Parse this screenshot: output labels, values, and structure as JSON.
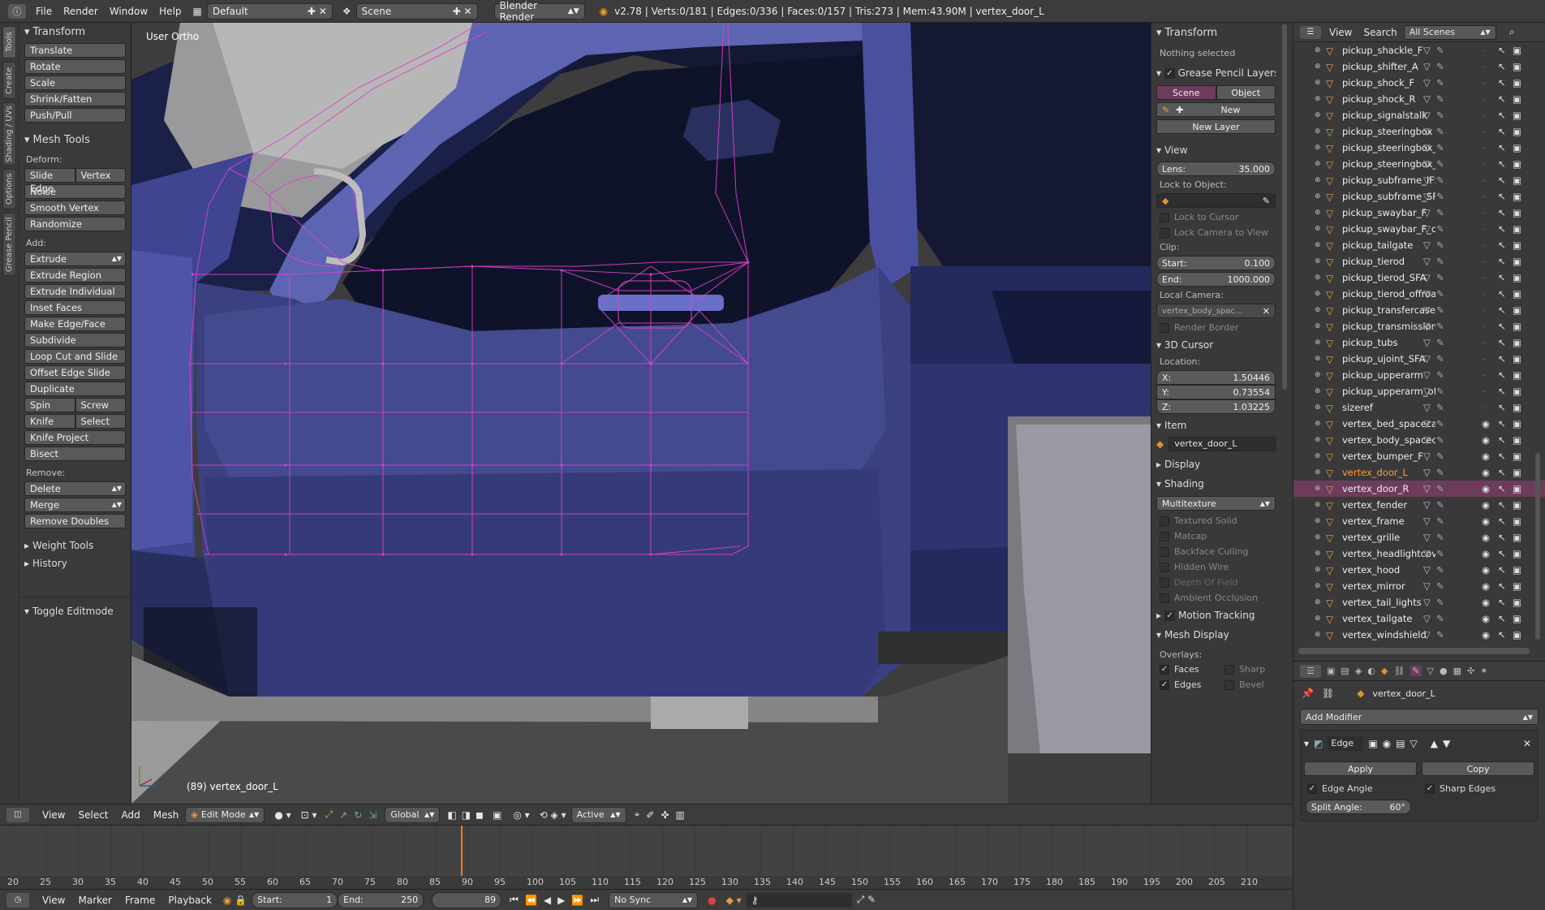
{
  "topbar": {
    "menus": [
      "File",
      "Render",
      "Window",
      "Help"
    ],
    "layout": "Default",
    "scene": "Scene",
    "engine": "Blender Render",
    "stats": "v2.78 | Verts:0/181 | Edges:0/336 | Faces:0/157 | Tris:273 | Mem:43.90M | vertex_door_L"
  },
  "left_tabs": [
    "Tools",
    "Create",
    "Shading / UVs",
    "Options",
    "Grease Pencil"
  ],
  "toolshelf": {
    "transform_title": "Transform",
    "transform": [
      "Translate",
      "Rotate",
      "Scale",
      "Shrink/Fatten",
      "Push/Pull"
    ],
    "mesh_tools_title": "Mesh Tools",
    "deform_label": "Deform:",
    "slide_edge": "Slide Edge",
    "vertex": "Vertex",
    "deform": [
      "Noise",
      "Smooth Vertex",
      "Randomize"
    ],
    "add_label": "Add:",
    "extrude": "Extrude",
    "add": [
      "Extrude Region",
      "Extrude Individual",
      "Inset Faces",
      "Make Edge/Face",
      "Subdivide",
      "Loop Cut and Slide",
      "Offset Edge Slide",
      "Duplicate"
    ],
    "spin": "Spin",
    "screw": "Screw",
    "knife": "Knife",
    "select": "Select",
    "add2": [
      "Knife Project",
      "Bisect"
    ],
    "remove_label": "Remove:",
    "delete": "Delete",
    "merge": "Merge",
    "remove_doubles": "Remove Doubles",
    "weight_tools": "Weight Tools",
    "history": "History",
    "toggle_editmode": "Toggle Editmode"
  },
  "viewport": {
    "view_name": "User Ortho",
    "object_label": "(89) vertex_door_L",
    "colors": {
      "body": "#3d4382",
      "body_light": "#5f66b4",
      "dark": "#151a3c",
      "wire": "#e040d0",
      "window": "#0e1022"
    }
  },
  "npanel": {
    "transform": "Transform",
    "nothing_selected": "Nothing selected",
    "grease_pencil": "Grease Pencil Layers",
    "scene_btn": "Scene",
    "object_btn": "Object",
    "new_btn": "New",
    "new_layer": "New Layer",
    "view": "View",
    "lens_label": "Lens:",
    "lens_value": "35.000",
    "lock_to_object": "Lock to Object:",
    "lock_cursor": "Lock to Cursor",
    "lock_camera": "Lock Camera to View",
    "clip": "Clip:",
    "start_label": "Start:",
    "start_value": "0.100",
    "end_label": "End:",
    "end_value": "1000.000",
    "local_camera": "Local Camera:",
    "local_camera_value": "vertex_body_spac...",
    "render_border": "Render Border",
    "cursor3d": "3D Cursor",
    "location": "Location:",
    "x_label": "X:",
    "x_value": "1.50446",
    "y_label": "Y:",
    "y_value": "0.73554",
    "z_label": "Z:",
    "z_value": "1.03225",
    "item": "Item",
    "item_name": "vertex_door_L",
    "display": "Display",
    "shading": "Shading",
    "shading_mode": "Multitexture",
    "shading_opts": [
      "Textured Solid",
      "Matcap",
      "Backface Culling",
      "Hidden Wire",
      "Depth Of Field",
      "Ambient Occlusion"
    ],
    "motion_tracking": "Motion Tracking",
    "mesh_display": "Mesh Display",
    "overlays": "Overlays:",
    "faces": "Faces",
    "sharp": "Sharp",
    "edges": "Edges",
    "bevel": "Bevel"
  },
  "outliner": {
    "view": "View",
    "search": "Search",
    "scenes": "All Scenes",
    "items": [
      "pickup_shackle_F",
      "pickup_shifter_A",
      "pickup_shock_F",
      "pickup_shock_R",
      "pickup_signalstalk",
      "pickup_steeringbox",
      "pickup_steeringbox_SFA",
      "pickup_steeringbox_offroad",
      "pickup_subframe_IFS",
      "pickup_subframe_SFA",
      "pickup_swaybar_F",
      "pickup_swaybar_F_offroad",
      "pickup_tailgate",
      "pickup_tierod",
      "pickup_tierod_SFA",
      "pickup_tierod_offroad",
      "pickup_transfercase",
      "pickup_transmission",
      "pickup_tubs",
      "pickup_ujoint_SFA",
      "pickup_upperarm",
      "pickup_upperarm_offroad",
      "sizeref",
      "vertex_bed_spacecab",
      "vertex_body_spacecab",
      "vertex_bumper_F",
      "vertex_door_L",
      "vertex_door_R",
      "vertex_fender",
      "vertex_frame",
      "vertex_grille",
      "vertex_headlightcover_R",
      "vertex_hood",
      "vertex_mirror",
      "vertex_tail_lights",
      "vertex_tailgate",
      "vertex_windshield"
    ],
    "active": "vertex_door_L",
    "selected": "vertex_door_R"
  },
  "properties": {
    "object_name": "vertex_door_L",
    "add_modifier": "Add Modifier",
    "modifier_name": "Edge",
    "apply": "Apply",
    "copy": "Copy",
    "edge_angle": "Edge Angle",
    "sharp_edges": "Sharp Edges",
    "split_angle_label": "Split Angle:",
    "split_angle_value": "60°"
  },
  "view_header": {
    "menus": [
      "View",
      "Select",
      "Add",
      "Mesh"
    ],
    "mode": "Edit Mode",
    "orientation": "Global",
    "pivot": "Active"
  },
  "timeline": {
    "ticks": [
      "20",
      "25",
      "30",
      "35",
      "40",
      "45",
      "50",
      "55",
      "60",
      "65",
      "70",
      "75",
      "80",
      "85",
      "90",
      "95",
      "100",
      "105",
      "110",
      "115",
      "120",
      "125",
      "130",
      "135",
      "140",
      "145",
      "150",
      "155",
      "160",
      "165",
      "170",
      "175",
      "180",
      "185",
      "190",
      "195",
      "200",
      "205",
      "210"
    ],
    "current_frame": 89,
    "menus": [
      "View",
      "Marker",
      "Frame",
      "Playback"
    ],
    "start_label": "Start:",
    "start": "1",
    "end_label": "End:",
    "end": "250",
    "frame": "89",
    "sync": "No Sync"
  }
}
